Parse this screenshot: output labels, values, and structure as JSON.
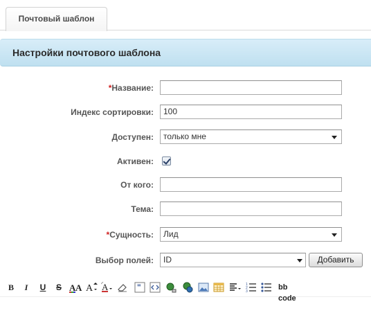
{
  "tabs": [
    {
      "label": "Почтовый шаблон"
    }
  ],
  "section": {
    "title": "Настройки почтового шаблона"
  },
  "form": {
    "required_mark": "*",
    "name": {
      "label": "Название:",
      "value": ""
    },
    "sort": {
      "label": "Индекс сортировки:",
      "value": "100"
    },
    "available": {
      "label": "Доступен:",
      "value": "только мне"
    },
    "active": {
      "label": "Активен:",
      "checked": true
    },
    "from": {
      "label": "От кого:",
      "value": ""
    },
    "subject": {
      "label": "Тема:",
      "value": ""
    },
    "entity": {
      "label": "Сущность:",
      "value": "Лид"
    },
    "fields": {
      "label": "Выбор полей:",
      "value": "ID",
      "add_button": "Добавить"
    }
  },
  "toolbar": {
    "bold": "B",
    "italic": "I",
    "underline": "U",
    "strike": "S",
    "bbcode": "bb code"
  },
  "colors": {
    "accent": "#bfe0f0",
    "required": "#d02020"
  }
}
